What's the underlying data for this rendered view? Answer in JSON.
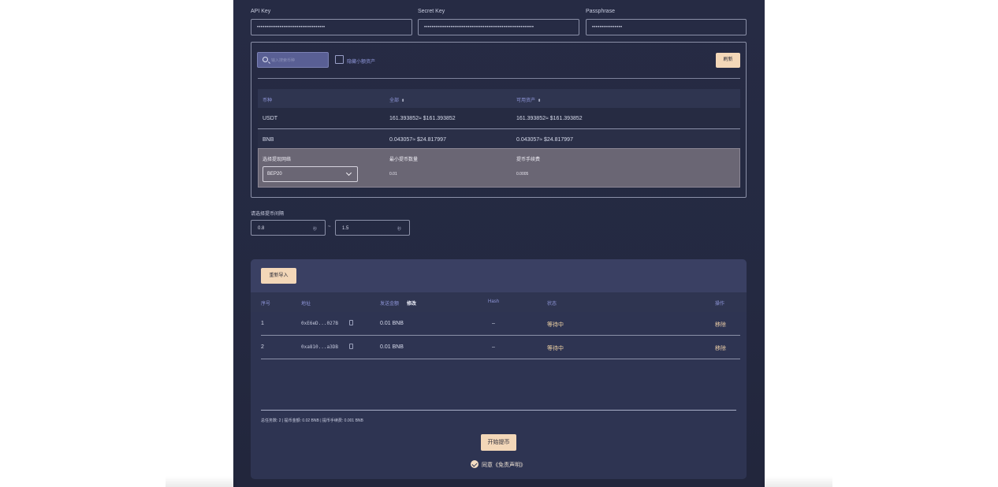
{
  "credentials": {
    "api_key_label": "API Key",
    "api_key_value": "••••••••••••••••••••••••••••••••••••",
    "secret_key_label": "Secret Key",
    "secret_key_value": "••••••••••••••••••••••••••••••••••••••••••••••••••••••••••",
    "passphrase_label": "Passphrase",
    "passphrase_value": "••••••••••••••••"
  },
  "assets": {
    "search_placeholder": "输入搜索币种",
    "hide_small_label": "隐藏小额资产",
    "refresh_label": "刷新",
    "columns": [
      "币种",
      "全部",
      "可用资产"
    ],
    "sort_glyph": "⬍",
    "rows": [
      {
        "coin": "USDT",
        "total": "161.393852≈ $161.393852",
        "available": "161.393852≈ $161.393852"
      },
      {
        "coin": "BNB",
        "total": "0.043057≈ $24.817997",
        "available": "0.043057≈ $24.817997"
      }
    ],
    "detail": {
      "network_label": "选择提现网络",
      "network_value": "BEP20",
      "min_label": "最小提币数量",
      "min_value": "0.01",
      "fee_label": "提币手续费",
      "fee_value": "0.0005"
    }
  },
  "interval": {
    "label": "请选择提币间隔",
    "min_value": "0.8",
    "max_value": "1.5",
    "unit": "秒",
    "separator": "~"
  },
  "tasks": {
    "reimport_label": "重新导入",
    "columns": {
      "index": "序号",
      "address": "地址",
      "amount": "发送金额",
      "amount_edit": "修改",
      "hash": "Hash",
      "status": "状态",
      "action": "操作"
    },
    "rows": [
      {
        "index": "1",
        "address": "0xE6eD...027B",
        "amount": "0.01 BNB",
        "hash": "–",
        "status": "等待中",
        "action": "移除"
      },
      {
        "index": "2",
        "address": "0xa810...a3DB",
        "amount": "0.01 BNB",
        "hash": "–",
        "status": "等待中",
        "action": "移除"
      }
    ],
    "summary": "总任务数:  2   |   提币金额:  0.02 BNB   |   提币手续费:  0.001 BNB",
    "start_label": "开始提币",
    "agree_text": "同意《免责声明》"
  },
  "colors": {
    "panel_bg": "#262b44",
    "accent_button": "#f3d7b8",
    "header_text": "#8e95d8",
    "status_waiting": "#f0d3a5"
  },
  "icons": [
    "search-icon",
    "checkbox-icon",
    "sort-icon",
    "chevron-down-icon",
    "copy-icon",
    "check-circle-icon"
  ]
}
